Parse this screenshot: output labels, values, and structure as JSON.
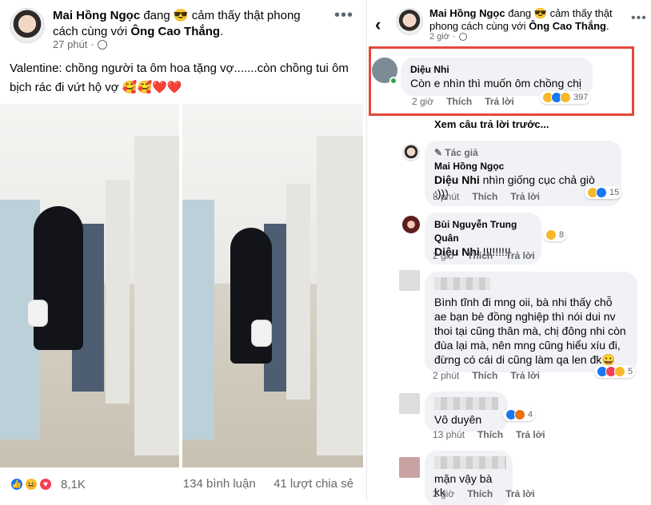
{
  "left_post": {
    "author": "Mai Hồng Ngọc",
    "activity": "đang 😎 cảm thấy thật phong cách cùng với",
    "with_name": "Ông Cao Thắng",
    "time": "27 phút",
    "text": "Valentine: chồng người ta ôm hoa tặng vợ.......còn chồng tui ôm bịch rác đi vứt hộ vợ 🥰🥰❤️❤️",
    "reaction_count": "8,1K",
    "comments": "134 bình luận",
    "shares": "41 lượt chia sẻ"
  },
  "right_post": {
    "author": "Mai Hồng Ngọc",
    "activity": "đang 😎 cảm thấy thật phong cách cùng với",
    "with_name": "Ông Cao Thắng",
    "time": "2 giờ",
    "view_previous": "Xem câu trả lời trước..."
  },
  "comments": [
    {
      "name": "Diệu Nhi",
      "text": "Còn e nhìn thì muốn ôm chồng chị",
      "time": "2 giờ",
      "like": "Thích",
      "reply": "Trả lời",
      "reacts": "397"
    },
    {
      "tag": "Tác giả",
      "name": "Mai Hồng Ngọc",
      "mention": "Diệu Nhi",
      "text": "nhìn giống cục chả giò :)))",
      "time": "8 phút",
      "like": "Thích",
      "reply": "Trả lời",
      "reacts": "15"
    },
    {
      "name": "Bùi Nguyễn Trung Quân",
      "mention": "Diệu Nhi",
      "text": "!!!!!!!!!",
      "time": "2 giờ",
      "like": "Thích",
      "reply": "Trả lời",
      "reacts": "8"
    },
    {
      "text": "Bình tĩnh đi mng oii, bà nhi thấy chỗ ae bạn bè đồng nghiệp thì nói dui nv thoi tại cũng thân mà, chị đông nhi còn đùa lại mà, nên mng cũng hiểu xíu đi, đừng có cái di cũng làm qa len đk😀",
      "time": "2 phút",
      "like": "Thích",
      "reply": "Trả lời",
      "reacts": "5"
    },
    {
      "text": "Vô duyên",
      "time": "13 phút",
      "like": "Thích",
      "reply": "Trả lời",
      "reacts": "4"
    },
    {
      "text": "mặn vậy bà kk",
      "time": "2 giờ",
      "like": "Thích",
      "reply": "Trả lời"
    }
  ],
  "colors": {
    "highlight": "#e5483a",
    "like": "#1877f2",
    "love": "#f33e58",
    "haha": "#f7b928"
  }
}
